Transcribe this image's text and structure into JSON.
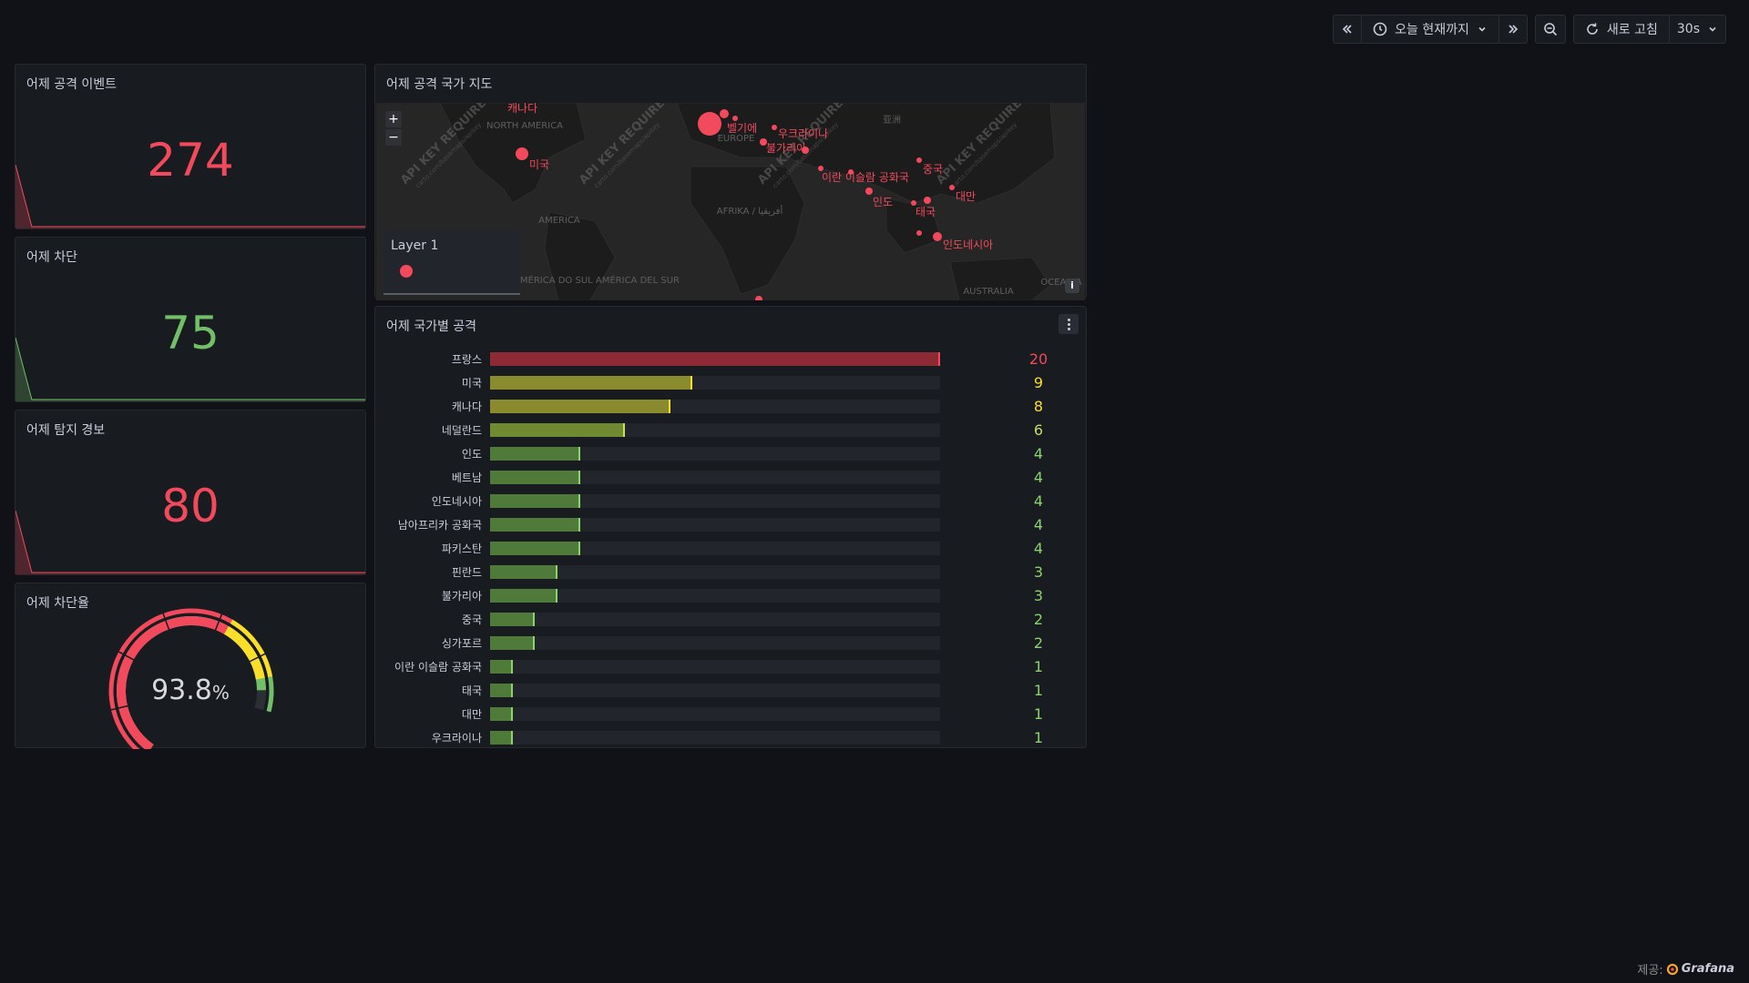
{
  "toolbar": {
    "time_range": "오늘 현재까지",
    "refresh_label": "새로 고침",
    "refresh_interval": "30s"
  },
  "panels": {
    "attack_events": {
      "title": "어제 공격 이벤트",
      "value": "274",
      "color": "#f2495c"
    },
    "blocked": {
      "title": "어제 차단",
      "value": "75",
      "color": "#73bf69"
    },
    "alerts": {
      "title": "어제 탐지 경보",
      "value": "80",
      "color": "#f2495c"
    },
    "block_rate": {
      "title": "어제 차단율",
      "value": "93.8",
      "unit": "%",
      "fraction": 0.938
    },
    "map": {
      "title": "어제 공격 국가 지도",
      "legend_title": "Layer 1",
      "zoom_in": "+",
      "zoom_out": "−",
      "info": "i",
      "watermark": "API KEY REQUIRED",
      "watermark_sub": "carto.com/basemaps/apikey",
      "continent_labels": [
        "NORTH AMERICA",
        "EUROPE",
        "AFRIKA / أفريقيا",
        "AMÉRICA DO SUL AMÉRICA DEL SUR",
        "AUSTRALIA",
        "亚洲",
        "AMERICA",
        "OCEANIA"
      ],
      "country_labels": [
        "캐나다",
        "미국",
        "벨기에",
        "우크라이나",
        "불가리아",
        "이란 이슬람 공화국",
        "인도",
        "중국",
        "대만",
        "태국",
        "인도네시아"
      ]
    },
    "by_country": {
      "title": "어제 국가별 공격",
      "rows": [
        {
          "country": "프랑스",
          "value": 20
        },
        {
          "country": "미국",
          "value": 9
        },
        {
          "country": "캐나다",
          "value": 8
        },
        {
          "country": "네덜란드",
          "value": 6
        },
        {
          "country": "인도",
          "value": 4
        },
        {
          "country": "베트남",
          "value": 4
        },
        {
          "country": "인도네시아",
          "value": 4
        },
        {
          "country": "남아프리카 공화국",
          "value": 4
        },
        {
          "country": "파키스탄",
          "value": 4
        },
        {
          "country": "핀란드",
          "value": 3
        },
        {
          "country": "불가리아",
          "value": 3
        },
        {
          "country": "중국",
          "value": 2
        },
        {
          "country": "싱가포르",
          "value": 2
        },
        {
          "country": "이란 이슬람 공화국",
          "value": 1
        },
        {
          "country": "태국",
          "value": 1
        },
        {
          "country": "대만",
          "value": 1
        },
        {
          "country": "우크라이나",
          "value": 1
        }
      ]
    }
  },
  "footer": {
    "prefix": "제공:",
    "brand": "Grafana"
  }
}
